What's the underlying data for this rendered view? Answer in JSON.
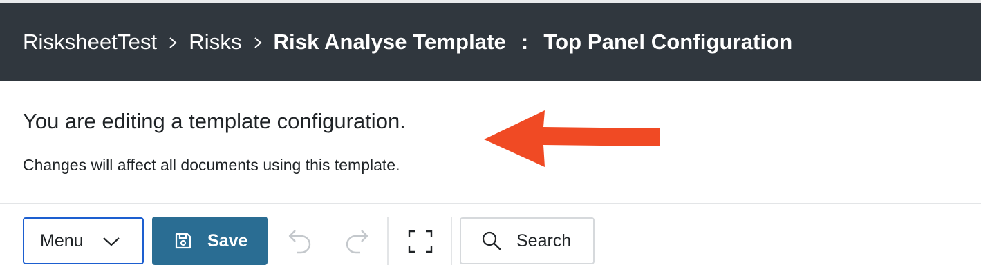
{
  "header": {
    "breadcrumb": [
      "RisksheetTest",
      "Risks",
      "Risk Analyse Template"
    ],
    "separator": ":",
    "page_title": "Top Panel Configuration"
  },
  "notice": {
    "title": "You are editing a template configuration.",
    "subtitle": "Changes will affect all documents using this template."
  },
  "toolbar": {
    "menu_label": "Menu",
    "save_label": "Save",
    "search_label": "Search"
  },
  "icons": {
    "menu": "chevron-down-icon",
    "save": "floppy-disk-icon",
    "undo": "undo-icon",
    "redo": "redo-icon",
    "fullscreen": "fullscreen-icon",
    "search": "search-icon",
    "annotation": "red-arrow"
  },
  "colors": {
    "header_bg": "#30373e",
    "save_bg": "#2a6d93",
    "menu_border": "#1d5fd0",
    "annotation_arrow": "#f04a24"
  }
}
